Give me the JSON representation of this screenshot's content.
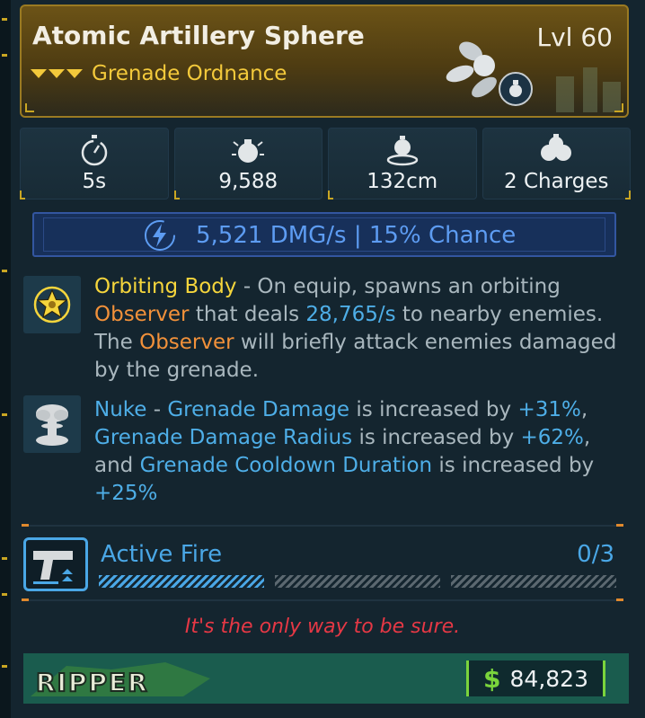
{
  "item": {
    "name": "Atomic Artillery Sphere",
    "level": "Lvl 60",
    "type": "Grenade Ordnance",
    "rarity_color": "#f3c93b"
  },
  "stats": [
    {
      "icon": "stopwatch-icon",
      "value": "5s"
    },
    {
      "icon": "damage-grenade-icon",
      "value": "9,588"
    },
    {
      "icon": "radius-grenade-icon",
      "value": "132cm"
    },
    {
      "icon": "charges-grenade-icon",
      "value": "2 Charges"
    }
  ],
  "elemental": {
    "icon": "lightning-bolt-icon",
    "text": "5,521 DMG/s | 15% Chance",
    "color": "#5d9cf2"
  },
  "perks": [
    {
      "icon": "star-badge-icon",
      "name": "Orbiting Body",
      "t1": " - On equip, spawns an orbiting ",
      "h1": "Observer",
      "t2": " that deals ",
      "h2": "28,765/s",
      "t3": " to nearby enemies. The ",
      "h3": "Observer",
      "t4": " will briefly attack enemies damaged by the grenade."
    },
    {
      "icon": "mushroom-cloud-icon",
      "name": "Nuke",
      "t1": " - ",
      "h1": "Grenade Damage",
      "t2": " is increased by ",
      "h2": "+31%",
      "t3": ", ",
      "h3": "Grenade Damage Radius",
      "t4": " is increased by ",
      "h4": "+62%",
      "t5": ", and ",
      "h5": "Grenade Cooldown Duration",
      "t6": " is increased by ",
      "h6": "+25%"
    }
  ],
  "active_fire": {
    "icon": "pistol-icon",
    "label": "Active Fire",
    "count": "0/3",
    "progress": 0.33
  },
  "flavor_text": "It's the only way to be sure.",
  "manufacturer": "RIPPER",
  "price": {
    "symbol": "$",
    "amount": "84,823"
  }
}
